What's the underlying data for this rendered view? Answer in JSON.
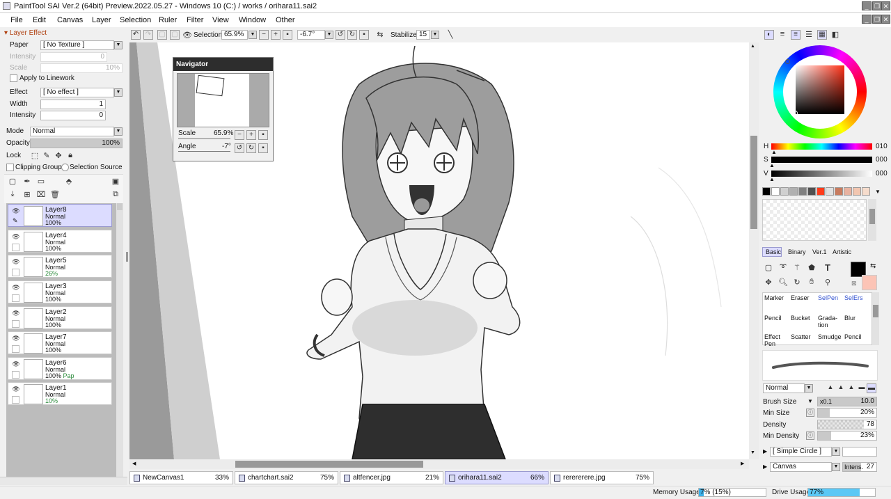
{
  "window": {
    "title": "PaintTool SAI Ver.2 (64bit) Preview.2022.05.27 - Windows 10 (C:) / works / orihara11.sai2",
    "minimize": "_",
    "restore": "❐",
    "close": "✕"
  },
  "menu": [
    "File",
    "Edit",
    "Canvas",
    "Layer",
    "Selection",
    "Ruler",
    "Filter",
    "View",
    "Window",
    "Other"
  ],
  "toolbar": {
    "selection_label": "Selection",
    "zoom": "65.9%",
    "angle": "-6.7°",
    "stabilizer_label": "Stabilizer",
    "stabilizer_value": "15"
  },
  "layer_effect": {
    "header": "Layer Effect",
    "paper_label": "Paper",
    "paper_value": "[ No Texture ]",
    "intensity_label": "Intensity",
    "intensity_value": "0",
    "scale_label": "Scale",
    "scale_value": "10%",
    "apply_linework": "Apply to Linework",
    "effect_label": "Effect",
    "effect_value": "[ No effect ]",
    "width_label": "Width",
    "width_value": "1",
    "intensity2_label": "Intensity",
    "intensity2_value": "0"
  },
  "layer_props": {
    "mode_label": "Mode",
    "mode_value": "Normal",
    "opacity_label": "Opacity",
    "opacity_value": "100%",
    "opacity_level": 1.0,
    "lock_label": "Lock",
    "clipping_group": "Clipping Group",
    "selection_source": "Selection Source"
  },
  "layers": [
    {
      "name": "Layer8",
      "mode": "Normal",
      "opacity": "100%",
      "extra": "",
      "selected": true
    },
    {
      "name": "Layer4",
      "mode": "Normal",
      "opacity": "100%",
      "extra": ""
    },
    {
      "name": "Layer5",
      "mode": "Normal",
      "opacity": "26%",
      "extra": ""
    },
    {
      "name": "Layer3",
      "mode": "Normal",
      "opacity": "100%",
      "extra": ""
    },
    {
      "name": "Layer2",
      "mode": "Normal",
      "opacity": "100%",
      "extra": ""
    },
    {
      "name": "Layer7",
      "mode": "Normal",
      "opacity": "100%",
      "extra": ""
    },
    {
      "name": "Layer6",
      "mode": "Normal",
      "opacity": "100%",
      "extra": "Pap"
    },
    {
      "name": "Layer1",
      "mode": "Normal",
      "opacity": "10%",
      "extra": ""
    }
  ],
  "navigator": {
    "title": "Navigator",
    "scale_label": "Scale",
    "scale_value": "65.9%",
    "angle_label": "Angle",
    "angle_value": "-7°"
  },
  "color": {
    "h_label": "H",
    "h_value": "010",
    "h_level": 0.03,
    "s_label": "S",
    "s_value": "000",
    "v_label": "V",
    "v_value": "000",
    "swatches": [
      "#000000",
      "#ffffff",
      "#d0d0d0",
      "#b0b0b0",
      "#808080",
      "#505050",
      "#ff3b1a",
      "#e0e0e0",
      "#c87b5e",
      "#e8b2a0",
      "#f2c6b0",
      "#f6dccc"
    ]
  },
  "tool_tabs": [
    "Basic",
    "Binary",
    "Ver.1",
    "Artistic"
  ],
  "brushes": [
    [
      "Marker",
      "Eraser",
      "SelPen",
      "SelErs"
    ],
    [
      "Pencil",
      "Bucket",
      "Grada-tion",
      "Blur"
    ],
    [
      "Effect Pen",
      "Scatter",
      "Smudge",
      "Pencil"
    ]
  ],
  "brush_settings": {
    "blend_mode": "Normal",
    "brush_size_label": "Brush Size",
    "brush_size_mult": "x0.1",
    "brush_size_value": "10.0",
    "min_size_label": "Min Size",
    "min_size_value": "20%",
    "min_size_level": 0.2,
    "density_label": "Density",
    "density_value": "78",
    "density_level": 0.78,
    "min_density_label": "Min Density",
    "min_density_value": "23%",
    "min_density_level": 0.23,
    "shape": "[ Simple Circle ]",
    "texture": "Canvas",
    "intens_label": "Intens.",
    "intens_value": "27"
  },
  "tabs": [
    {
      "name": "NewCanvas1",
      "pct": "33%"
    },
    {
      "name": "chartchart.sai2",
      "pct": "75%"
    },
    {
      "name": "altfencer.jpg",
      "pct": "21%"
    },
    {
      "name": "orihara11.sai2",
      "pct": "66%",
      "selected": true
    },
    {
      "name": "rerererere.jpg",
      "pct": "75%"
    }
  ],
  "status": {
    "memory_label": "Memory Usage",
    "memory_value": "7% (15%)",
    "memory_level": 0.07,
    "drive_label": "Drive Usage",
    "drive_value": "77%",
    "drive_level": 0.77
  }
}
